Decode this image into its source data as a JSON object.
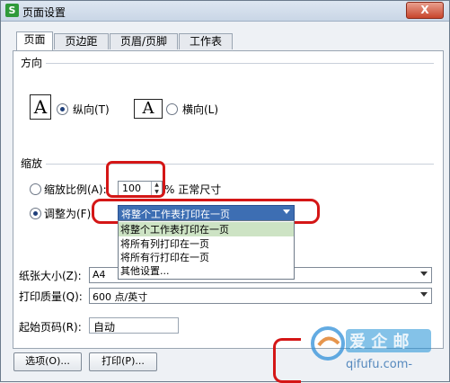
{
  "window": {
    "title": "页面设置",
    "app_icon_glyph": "S",
    "close_label": "X",
    "close_color": "#c8452c"
  },
  "tabs": [
    {
      "label": "页面",
      "active": true
    },
    {
      "label": "页边距",
      "active": false
    },
    {
      "label": "页眉/页脚",
      "active": false
    },
    {
      "label": "工作表",
      "active": false
    }
  ],
  "orientation": {
    "title": "方向",
    "portrait_icon_glyph": "A",
    "portrait_label": "纵向(T)",
    "landscape_icon_glyph": "A",
    "landscape_label": "横向(L)",
    "selected": "portrait"
  },
  "scaling": {
    "title": "缩放",
    "scale_label": "缩放比例(A):",
    "scale_value": "100",
    "scale_unit": "% 正常尺寸",
    "fit_label": "调整为(F):",
    "fit_selected": "将整个工作表打印在一页",
    "selected": "fit",
    "fit_options": [
      "将整个工作表打印在一页",
      "将所有列打印在一页",
      "将所有行打印在一页",
      "其他设置..."
    ]
  },
  "paper": {
    "size_label": "纸张大小(Z):",
    "size_value": "A4",
    "quality_label": "打印质量(Q):",
    "quality_value": "600 点/英寸"
  },
  "first_page": {
    "label": "起始页码(R):",
    "value": "自动"
  },
  "buttons": {
    "options": "选项(O)...",
    "print": "打印(P)..."
  },
  "watermark": {
    "text": "qifufu.com-"
  },
  "colors": {
    "highlight_red": "#d41616",
    "selection_blue": "#3d6eb3",
    "dropdown_highlight": "#cde3c4"
  }
}
